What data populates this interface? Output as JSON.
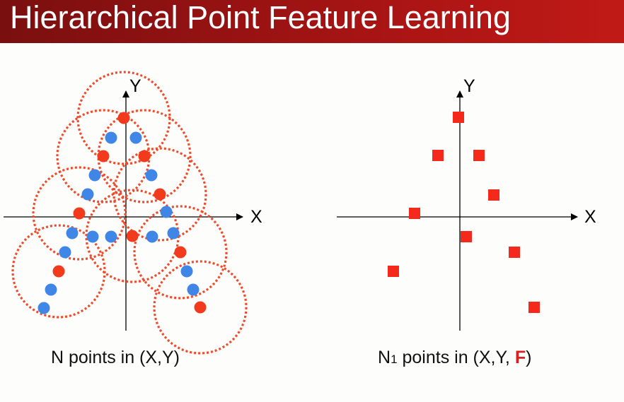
{
  "header": {
    "title": "Hierarchical Point Feature Learning"
  },
  "colors": {
    "sampled": "#f23a1c",
    "point": "#3f86e6",
    "square": "#f5281c",
    "circle": "#f04a2a",
    "feature": "#d81e1e"
  },
  "left": {
    "x_label": "X",
    "y_label": "Y",
    "caption": "N points in (X,Y)",
    "sampled_points": [
      [
        -3,
        140
      ],
      [
        -32,
        86
      ],
      [
        26,
        86
      ],
      [
        48,
        32
      ],
      [
        -66,
        5
      ],
      [
        9,
        -27
      ],
      [
        77,
        -50
      ],
      [
        -95,
        -77
      ],
      [
        105,
        -128
      ]
    ],
    "other_points": [
      [
        -21,
        112
      ],
      [
        14,
        112
      ],
      [
        -44,
        59
      ],
      [
        36,
        59
      ],
      [
        -54,
        32
      ],
      [
        57,
        7
      ],
      [
        -76,
        -23
      ],
      [
        -47,
        -28
      ],
      [
        -21,
        -28
      ],
      [
        37,
        -28
      ],
      [
        67,
        -23
      ],
      [
        -86,
        -50
      ],
      [
        86,
        -77
      ],
      [
        95,
        -103
      ],
      [
        -106,
        -103
      ],
      [
        -116,
        -129
      ]
    ],
    "ball_radius": 65
  },
  "right": {
    "x_label": "X",
    "y_label": "Y",
    "caption_prefix": "N",
    "caption_sub": "1",
    "caption_mid": " points in (X,Y, ",
    "caption_feature": "F",
    "caption_suffix": ")",
    "points": [
      [
        -2,
        141
      ],
      [
        -31,
        87
      ],
      [
        27,
        87
      ],
      [
        48,
        31
      ],
      [
        -64,
        5
      ],
      [
        9,
        -28
      ],
      [
        77,
        -50
      ],
      [
        -94,
        -77
      ],
      [
        105,
        -128
      ]
    ]
  }
}
